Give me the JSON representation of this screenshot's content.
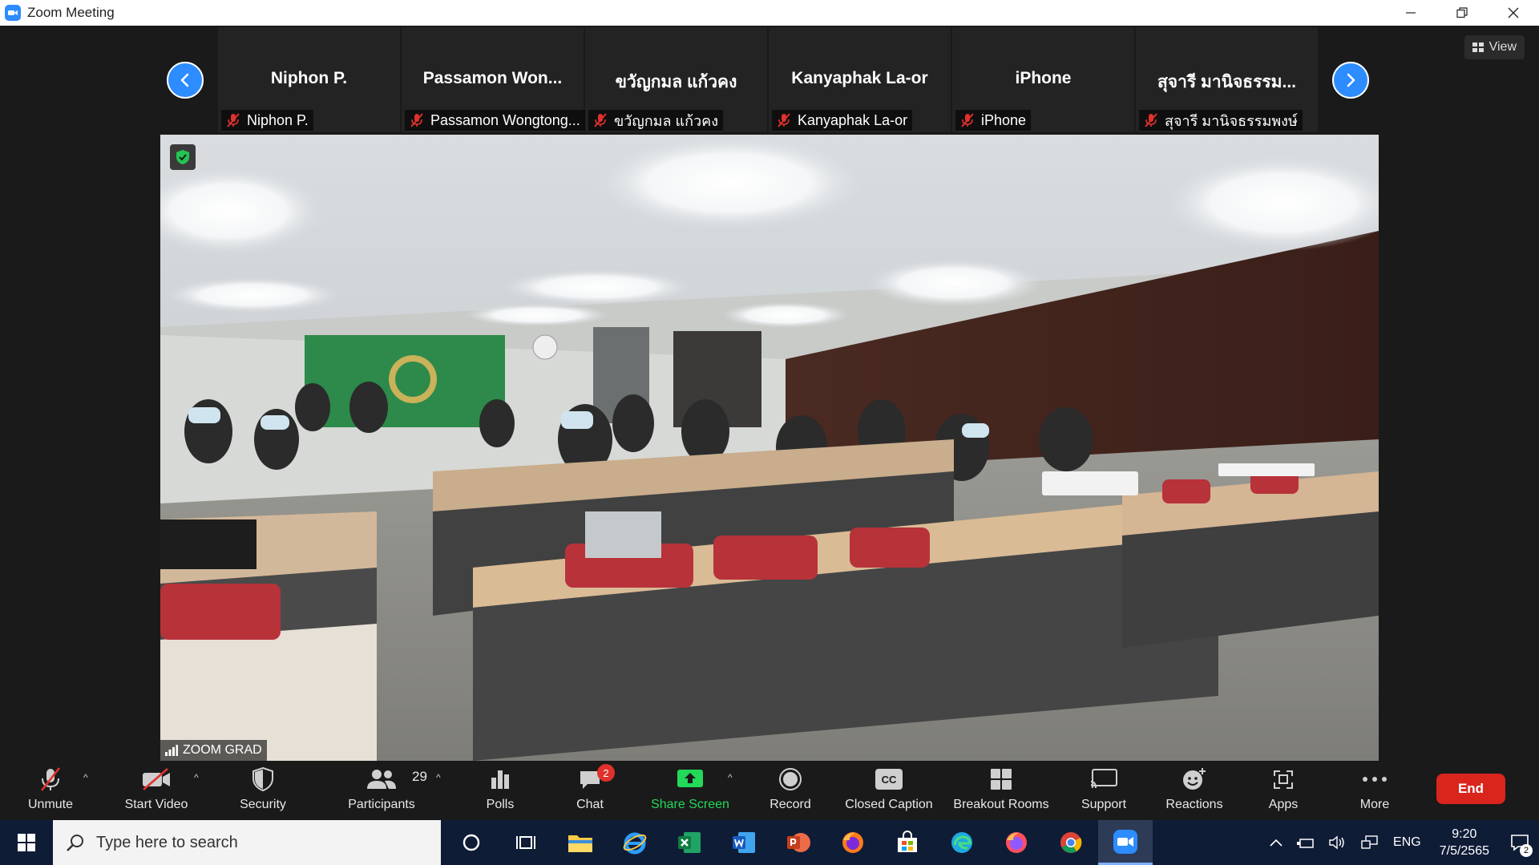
{
  "window": {
    "title": "Zoom Meeting"
  },
  "view_button": {
    "label": "View"
  },
  "thumbnails": [
    {
      "display": "Niphon P.",
      "name": "Niphon P."
    },
    {
      "display": "Passamon Won...",
      "name": "Passamon Wongtong..."
    },
    {
      "display": "ขวัญกมล แก้วคง",
      "name": "ขวัญกมล แก้วคง"
    },
    {
      "display": "Kanyaphak La-or",
      "name": "Kanyaphak La-or"
    },
    {
      "display": "iPhone",
      "name": "iPhone"
    },
    {
      "display": "สุจารี มานิจธรรม...",
      "name": "สุจารี มานิจธรรมพงษ์"
    }
  ],
  "video": {
    "speaker_name": "ZOOM GRAD"
  },
  "toolbar": {
    "unmute": "Unmute",
    "start_video": "Start Video",
    "security": "Security",
    "participants": "Participants",
    "participant_count": "29",
    "polls": "Polls",
    "chat": "Chat",
    "chat_badge": "2",
    "share_screen": "Share Screen",
    "record": "Record",
    "closed_caption": "Closed Caption",
    "cc_glyph": "CC",
    "breakout_rooms": "Breakout Rooms",
    "support": "Support",
    "reactions": "Reactions",
    "apps": "Apps",
    "more": "More",
    "end": "End"
  },
  "taskbar": {
    "search_placeholder": "Type here to search",
    "language": "ENG",
    "time": "9:20",
    "date": "7/5/2565",
    "notification_count": "2"
  },
  "colors": {
    "accent": "#2d8cff",
    "end_red": "#d9251c",
    "share_green": "#23d959",
    "muted_red": "#e0312c"
  }
}
